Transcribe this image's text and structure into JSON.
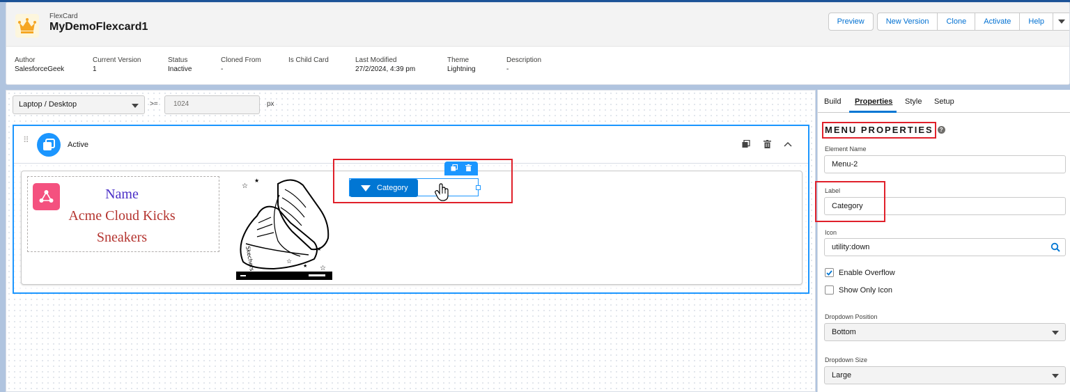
{
  "header": {
    "app_type": "FlexCard",
    "card_name": "MyDemoFlexcard1",
    "buttons": {
      "preview": "Preview",
      "new_version": "New Version",
      "clone": "Clone",
      "activate": "Activate",
      "help": "Help"
    }
  },
  "meta": {
    "author": {
      "label": "Author",
      "value": "SalesforceGeek"
    },
    "current_version": {
      "label": "Current Version",
      "value": "1"
    },
    "status": {
      "label": "Status",
      "value": "Inactive"
    },
    "cloned_from": {
      "label": "Cloned From",
      "value": "-"
    },
    "is_child_card": {
      "label": "Is Child Card",
      "value": ""
    },
    "last_modified": {
      "label": "Last Modified",
      "value": "27/2/2024, 4:39 pm"
    },
    "theme": {
      "label": "Theme",
      "value": "Lightning"
    },
    "description": {
      "label": "Description",
      "value": "-"
    }
  },
  "canvas": {
    "device": "Laptop / Desktop",
    "operator": ">=",
    "width_value": "1024",
    "unit": "px",
    "state_name": "Active",
    "field": {
      "name": "Name",
      "value_line1": "Acme Cloud Kicks",
      "value_line2": "Sneakers"
    },
    "menu_label": "Category"
  },
  "panel": {
    "tabs": {
      "build": "Build",
      "properties": "Properties",
      "style": "Style",
      "setup": "Setup"
    },
    "title": "MENU PROPERTIES",
    "element_name": {
      "label": "Element Name",
      "value": "Menu-2"
    },
    "label": {
      "label": "Label",
      "value": "Category"
    },
    "icon": {
      "label": "Icon",
      "value": "utility:down"
    },
    "enable_overflow": {
      "label": "Enable Overflow",
      "checked": true
    },
    "show_only_icon": {
      "label": "Show Only Icon",
      "checked": false
    },
    "dropdown_position": {
      "label": "Dropdown Position",
      "value": "Bottom"
    },
    "dropdown_size": {
      "label": "Dropdown Size",
      "value": "Large"
    }
  },
  "colors": {
    "brand": "#0176d3",
    "accent": "#1b96ff",
    "highlight": "#e0202a"
  },
  "icons": [
    "crown-icon",
    "caret-down-icon",
    "drag-handle-icon",
    "flexcard-state-icon",
    "clone-icon",
    "delete-icon",
    "chevron-up-icon",
    "relationship-icon",
    "hand-cursor-icon",
    "help-icon",
    "search-icon",
    "check-icon"
  ]
}
